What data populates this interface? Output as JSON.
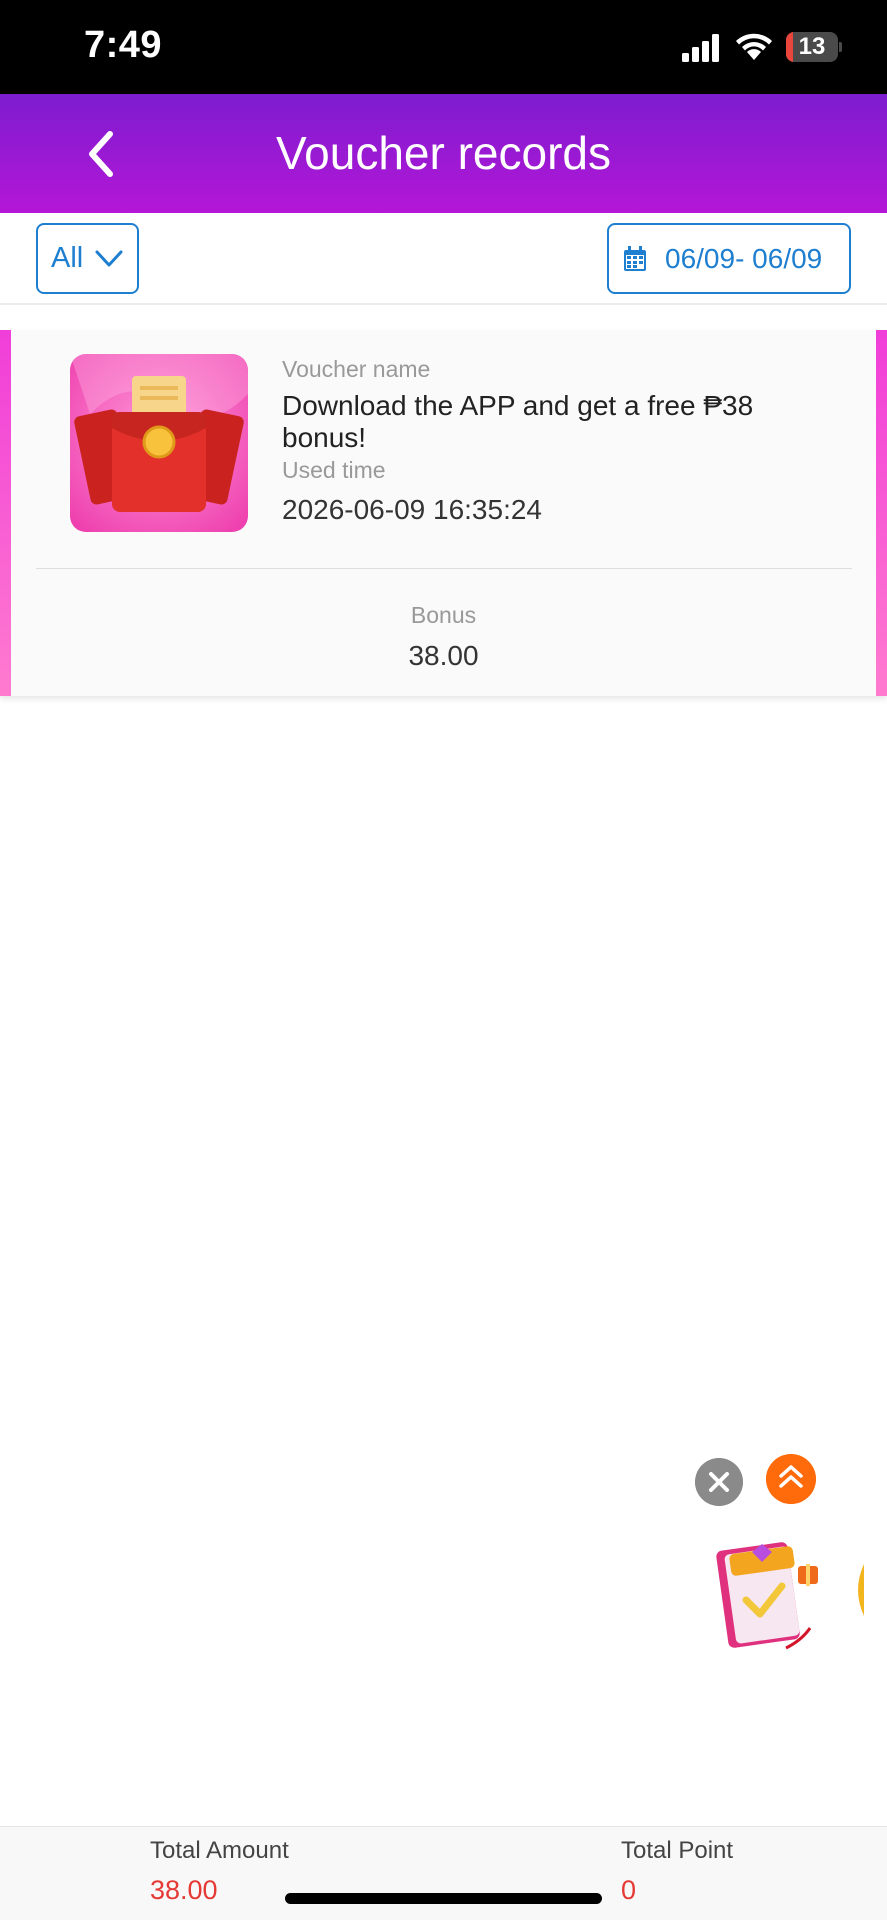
{
  "status_bar": {
    "time": "7:49",
    "battery_level": "13",
    "battery_fill_percent": 13,
    "icons": [
      "signal-icon",
      "wifi-icon",
      "battery-icon"
    ]
  },
  "header": {
    "title": "Voucher records",
    "back_icon": "chevron-left-icon"
  },
  "filters": {
    "type_select": "All",
    "date_range": "06/09- 06/09"
  },
  "records": [
    {
      "voucher_name_label": "Voucher name",
      "voucher_name": "Download the APP and get a free ₱38 bonus!",
      "used_time_label": "Used time",
      "used_time": "2026-06-09 16:35:24",
      "bonus_label": "Bonus",
      "bonus": "38.00",
      "image": "red-envelope-icon"
    }
  ],
  "floating": {
    "close_icon": "close-icon",
    "scroll_top_icon": "double-chevron-up-icon",
    "promo_icon": "promo-gift-icon"
  },
  "footer": {
    "total_amount_label": "Total Amount",
    "total_amount": "38.00",
    "total_point_label": "Total Point",
    "total_point": "0"
  },
  "colors": {
    "header_gradient_start": "#7d1ccf",
    "header_gradient_end": "#b417d6",
    "accent_blue": "#1e7fd0",
    "stripe_pink": "#f03ed8",
    "total_red": "#e53935"
  }
}
